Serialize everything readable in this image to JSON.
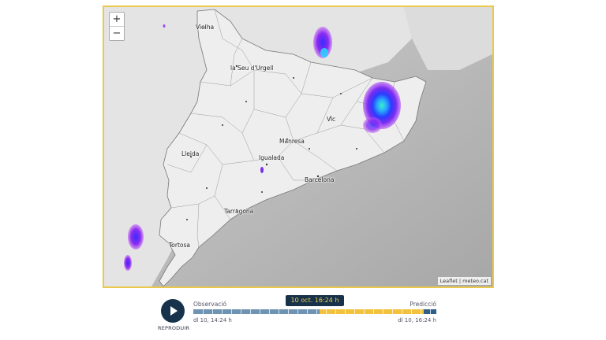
{
  "map": {
    "zoom_in": "+",
    "zoom_out": "−",
    "attribution": "Leaflet | meteo.cat",
    "cities": [
      {
        "name": "Vielha"
      },
      {
        "name": "la Seu d'Urgell"
      },
      {
        "name": "Vic"
      },
      {
        "name": "Manresa"
      },
      {
        "name": "Lleida"
      },
      {
        "name": "Igualada"
      },
      {
        "name": "Barcelona"
      },
      {
        "name": "Tarragona"
      },
      {
        "name": "Tortosa"
      }
    ],
    "colors": {
      "frame": "#e9c84a",
      "land": "#e8e8e8",
      "sea": "#b5b5b5",
      "radar_low": "#7b2cf0",
      "radar_mid": "#2a3cff",
      "radar_high": "#27e0d0"
    }
  },
  "timeline": {
    "play_label": "REPRODUIR",
    "observation_label": "Observació",
    "prediction_label": "Predicció",
    "current_time": "10 oct. 16:24 h",
    "start_time": "dl 10, 14:24 h",
    "end_time": "dl 10, 16:24 h",
    "observation_fraction": 0.52,
    "prediction_fraction": 0.43,
    "colors": {
      "observation": "#6f93b3",
      "prediction": "#f2c23c",
      "tail": "#2f5f86"
    }
  }
}
